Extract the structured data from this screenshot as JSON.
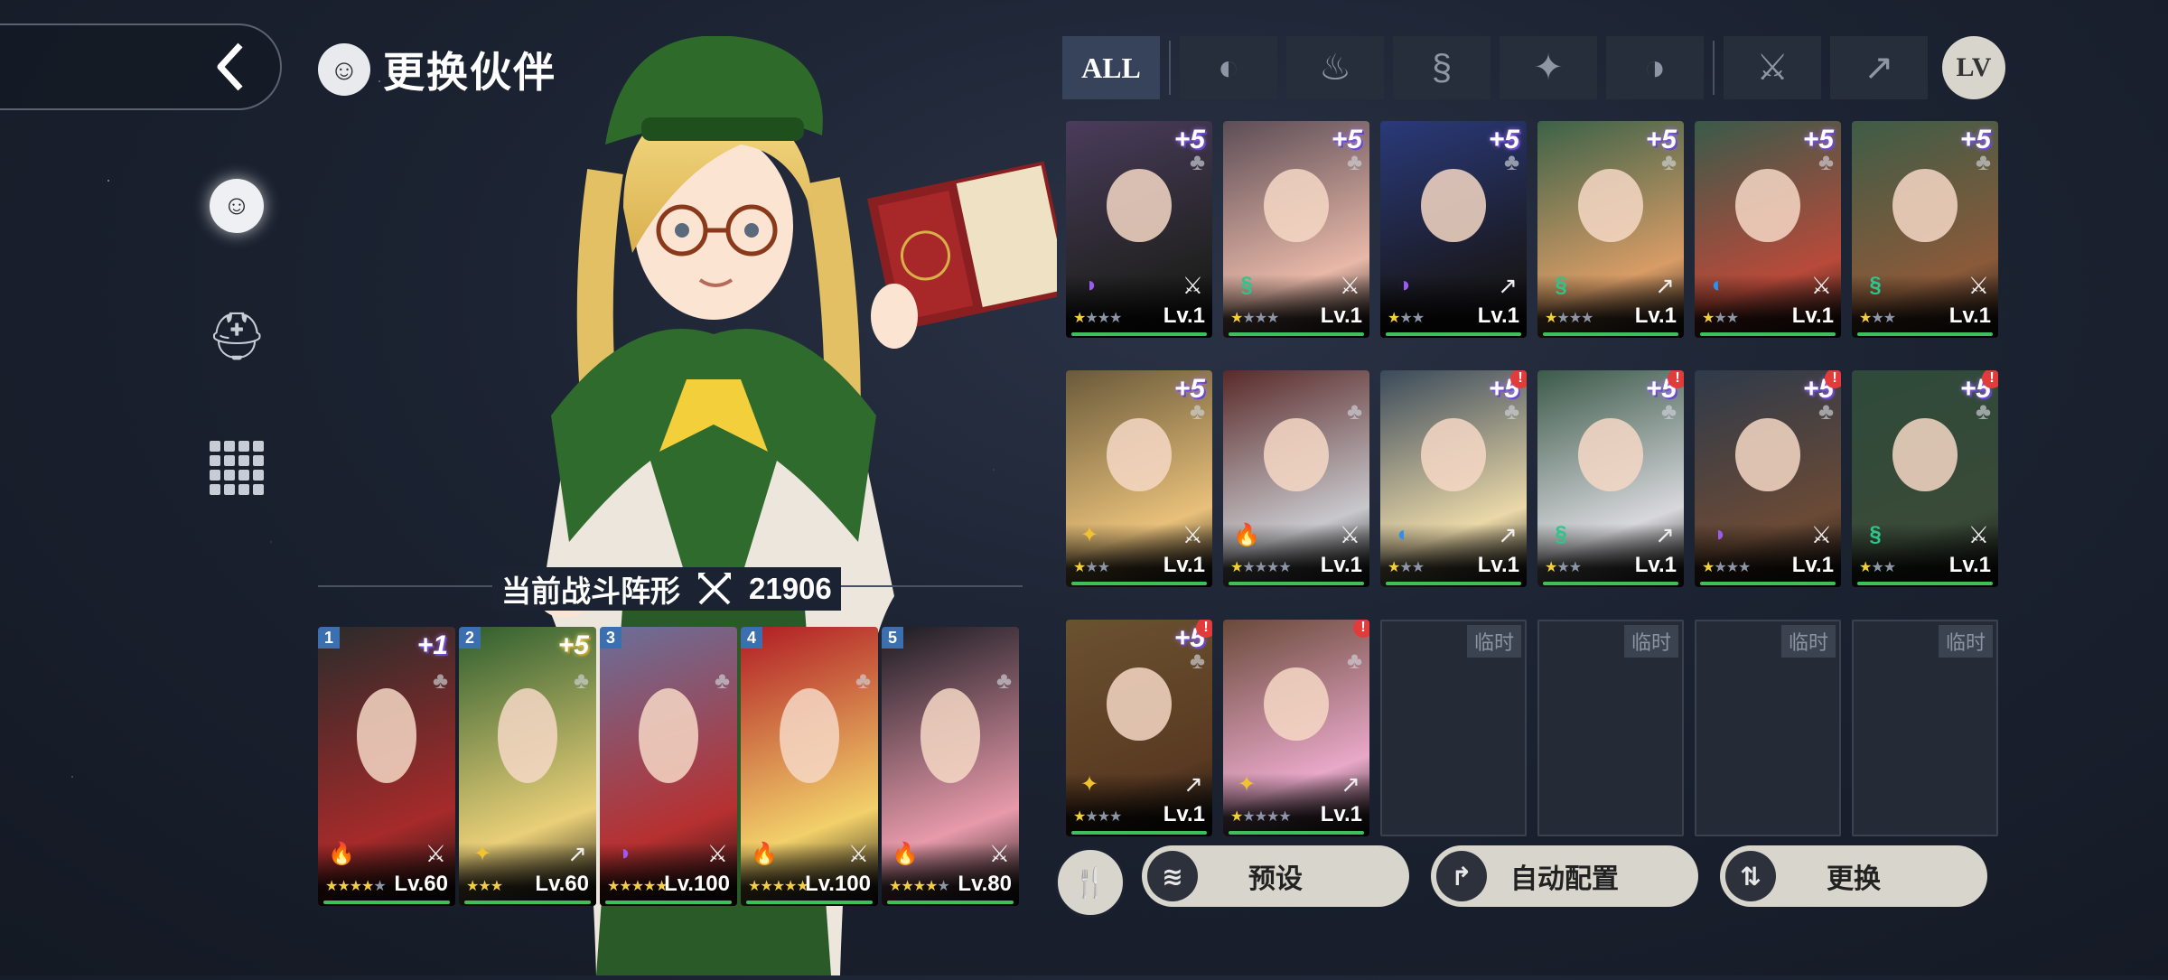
{
  "header": {
    "title": "更换伙伴"
  },
  "formation": {
    "label": "当前战斗阵形",
    "power": "21906"
  },
  "filters": {
    "all_label": "ALL",
    "lv_label": "LV"
  },
  "empty_slot_label": "临时",
  "buttons": {
    "preset": "预设",
    "auto": "自动配置",
    "swap": "更换"
  },
  "team": [
    {
      "slot": "1",
      "plus": "+1",
      "plus_style": "blue",
      "element": "fire",
      "weapon": "sword",
      "stars": 4,
      "max_stars": 5,
      "level": "Lv.60",
      "colors": [
        "#2b2b2b",
        "#a62a2a"
      ]
    },
    {
      "slot": "2",
      "plus": "+5",
      "plus_style": "gold",
      "element": "light",
      "weapon": "spear",
      "stars": 3,
      "max_stars": 3,
      "level": "Lv.60",
      "colors": [
        "#2e5e2e",
        "#e9cf78"
      ]
    },
    {
      "slot": "3",
      "plus": "",
      "plus_style": "",
      "element": "dark",
      "weapon": "sword",
      "stars": 5,
      "max_stars": 5,
      "level": "Lv.100",
      "colors": [
        "#6a6f9a",
        "#b73030"
      ]
    },
    {
      "slot": "4",
      "plus": "",
      "plus_style": "",
      "element": "fire",
      "weapon": "sword",
      "stars": 5,
      "max_stars": 5,
      "level": "Lv.100",
      "colors": [
        "#b01c24",
        "#f2d06a"
      ]
    },
    {
      "slot": "5",
      "plus": "",
      "plus_style": "",
      "element": "fire",
      "weapon": "sword",
      "stars": 4,
      "max_stars": 5,
      "level": "Lv.80",
      "colors": [
        "#1b1b22",
        "#e79aaa"
      ]
    }
  ],
  "roster": [
    {
      "plus": "+5",
      "alert": false,
      "element": "dark",
      "weapon": "sword",
      "stars": 1,
      "max_stars": 4,
      "level": "Lv.1",
      "colors": [
        "#4a3c5c",
        "#222"
      ]
    },
    {
      "plus": "+5",
      "alert": false,
      "element": "wind",
      "weapon": "sword",
      "stars": 1,
      "max_stars": 4,
      "level": "Lv.1",
      "colors": [
        "#5c4d56",
        "#e8b8a8"
      ]
    },
    {
      "plus": "+5",
      "alert": false,
      "element": "dark",
      "weapon": "spear",
      "stars": 1,
      "max_stars": 3,
      "level": "Lv.1",
      "colors": [
        "#2a3a7a",
        "#1a1a22"
      ]
    },
    {
      "plus": "+5",
      "alert": false,
      "element": "wind",
      "weapon": "spear",
      "stars": 1,
      "max_stars": 4,
      "level": "Lv.1",
      "colors": [
        "#3c6248",
        "#d89c66"
      ]
    },
    {
      "plus": "+5",
      "alert": false,
      "element": "water",
      "weapon": "sword",
      "stars": 1,
      "max_stars": 3,
      "level": "Lv.1",
      "colors": [
        "#3a5a4a",
        "#b84a3a"
      ]
    },
    {
      "plus": "+5",
      "alert": false,
      "element": "wind",
      "weapon": "sword",
      "stars": 1,
      "max_stars": 3,
      "level": "Lv.1",
      "colors": [
        "#3e5c46",
        "#8a5a3a"
      ]
    },
    {
      "plus": "+5",
      "alert": false,
      "element": "light",
      "weapon": "sword",
      "stars": 1,
      "max_stars": 3,
      "level": "Lv.1",
      "colors": [
        "#6a5a3a",
        "#e8c07a"
      ]
    },
    {
      "plus": "",
      "alert": false,
      "element": "fire",
      "weapon": "sword",
      "stars": 1,
      "max_stars": 5,
      "level": "Lv.1",
      "colors": [
        "#5a2a2a",
        "#c8c8cc"
      ]
    },
    {
      "plus": "+5",
      "alert": true,
      "element": "water",
      "weapon": "spear",
      "stars": 1,
      "max_stars": 3,
      "level": "Lv.1",
      "colors": [
        "#3a4a5a",
        "#ead8a8"
      ]
    },
    {
      "plus": "+5",
      "alert": true,
      "element": "wind",
      "weapon": "spear",
      "stars": 1,
      "max_stars": 3,
      "level": "Lv.1",
      "colors": [
        "#3c5a4a",
        "#d8d8dc"
      ]
    },
    {
      "plus": "+5",
      "alert": true,
      "element": "dark",
      "weapon": "sword",
      "stars": 1,
      "max_stars": 4,
      "level": "Lv.1",
      "colors": [
        "#2e3a4a",
        "#6a4a36"
      ]
    },
    {
      "plus": "+5",
      "alert": true,
      "element": "wind",
      "weapon": "sword",
      "stars": 1,
      "max_stars": 3,
      "level": "Lv.1",
      "colors": [
        "#2e4a3a",
        "#3a4a38"
      ]
    },
    {
      "plus": "+5",
      "alert": true,
      "element": "light",
      "weapon": "spear",
      "stars": 1,
      "max_stars": 4,
      "level": "Lv.1",
      "colors": [
        "#6a5230",
        "#5a3a22"
      ]
    },
    {
      "plus": "",
      "alert": true,
      "element": "light",
      "weapon": "spear",
      "stars": 1,
      "max_stars": 5,
      "level": "Lv.1",
      "colors": [
        "#6a4a3a",
        "#e8a8c8"
      ]
    }
  ],
  "empty_slots": 4,
  "element_colors": {
    "fire": "#e2363a",
    "water": "#2f8ff0",
    "wind": "#2fc48a",
    "light": "#f2c330",
    "dark": "#9a5cf0"
  },
  "element_glyphs": {
    "fire": "🔥",
    "water": "◐",
    "wind": "§",
    "light": "✦",
    "dark": "◑"
  },
  "weapon_glyphs": {
    "sword": "⚔",
    "spear": "↗"
  }
}
